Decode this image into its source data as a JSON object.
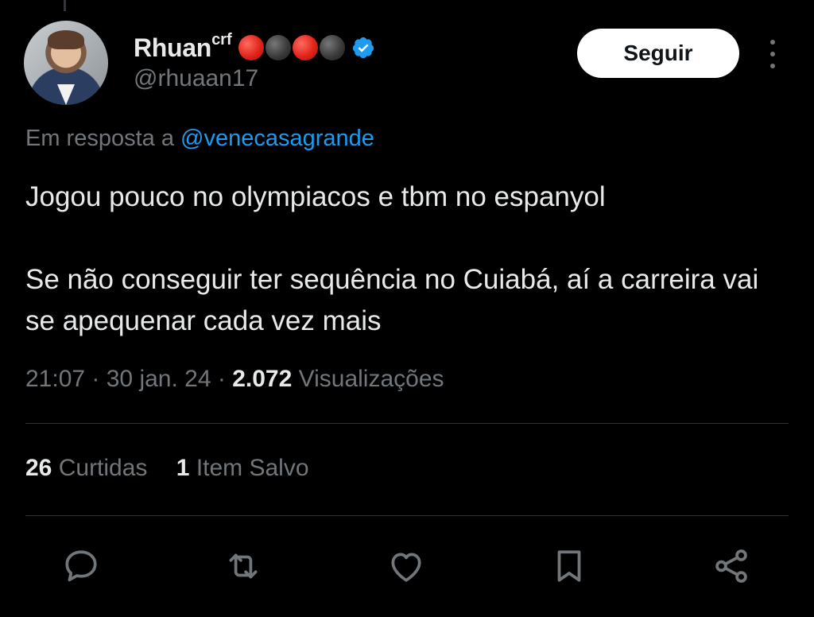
{
  "author": {
    "display_name": "Rhuan",
    "name_superscript": "crf",
    "badge_dots": [
      "red",
      "black",
      "red",
      "black"
    ],
    "verified": true,
    "handle": "@rhuaan17"
  },
  "follow_button_label": "Seguir",
  "reply_context": {
    "prefix": "Em resposta a",
    "mention": "@venecasagrande"
  },
  "tweet": {
    "paragraphs": [
      "Jogou pouco no olympiacos e tbm no espanyol",
      "Se não conseguir ter sequência no Cuiabá, aí a carreira vai se apequenar cada vez mais"
    ],
    "time": "21:07",
    "date": "30 jan. 24",
    "views_count": "2.072",
    "views_label": "Visualizações"
  },
  "stats": {
    "likes_count": "26",
    "likes_label": "Curtidas",
    "bookmarks_count": "1",
    "bookmarks_label": "Item Salvo"
  },
  "actions": [
    "reply-icon",
    "retweet-icon",
    "like-icon",
    "bookmark-icon",
    "share-icon"
  ],
  "colors": {
    "background": "#000000",
    "text_primary": "#e7e9ea",
    "text_secondary": "#71767b",
    "accent_blue": "#1d9bf0",
    "verified_blue": "#1d9bf0",
    "divider": "#2f3336"
  }
}
